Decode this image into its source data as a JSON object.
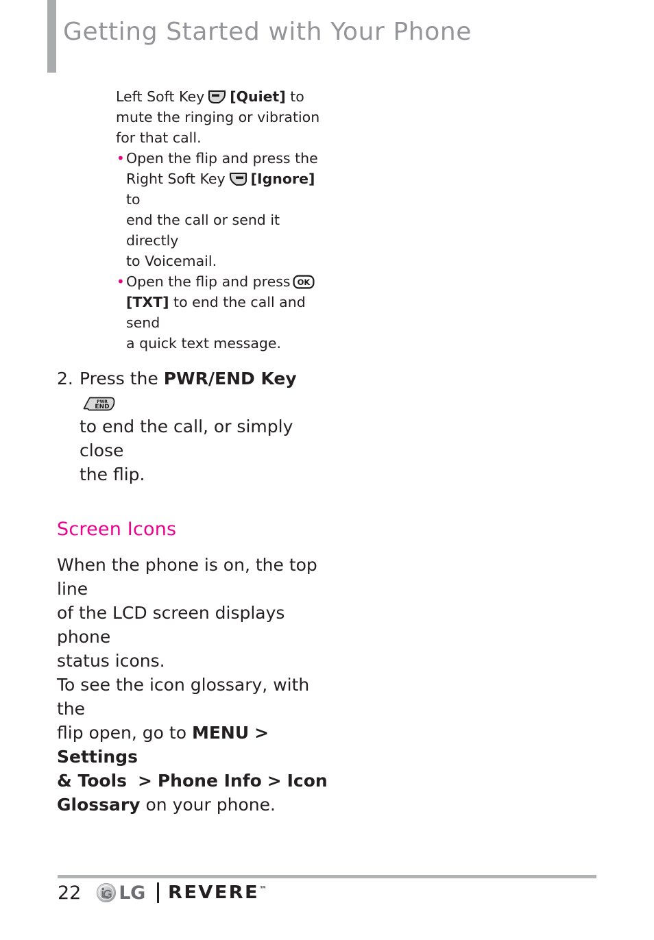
{
  "header": {
    "title": "Getting Started with Your Phone",
    "accent_bar_color": "#aaabad",
    "title_color": "#939598"
  },
  "colors": {
    "accent_pink": "#ec008c",
    "bullet_pink": "#e6007e",
    "body_text": "#231f20",
    "key_icon_fill": "#d9d9d9",
    "rule_gray": "#b1b3b5"
  },
  "content": {
    "intro_block": {
      "line1_prefix": "Left Soft Key",
      "left_soft_key_icon": "left-soft-key-icon",
      "line1_bold": "[Quiet]",
      "line1_suffix": "to",
      "line2": "mute the ringing or vibration",
      "line3": "for that call."
    },
    "bullets": [
      {
        "segments": [
          {
            "text": "Open the flip and press the",
            "bold": false
          },
          {
            "text": "Right Soft Key",
            "bold": false
          },
          {
            "icon": "right-soft-key-icon"
          },
          {
            "text": "[Ignore]",
            "bold": true
          },
          {
            "text": "to",
            "bold": false
          },
          {
            "text": "end the call or send it directly",
            "bold": false
          },
          {
            "text": "to Voicemail.",
            "bold": false
          }
        ],
        "line1": "Open the flip and press the",
        "line2_prefix": "Right Soft Key",
        "line2_bold": "[Ignore]",
        "line2_suffix": "to",
        "line3": "end the call or send it directly",
        "line4": "to Voicemail."
      },
      {
        "line1": "Open the flip and press",
        "icon": "ok-key-icon",
        "line2_bold": "[TXT]",
        "line2_suffix": "to end the call and send",
        "line3": "a quick text message."
      }
    ],
    "step_two": {
      "number": "2.",
      "prefix": "Press the",
      "bold": "PWR/END Key",
      "icon": "pwr-end-key-icon",
      "line2": "to end the call, or simply close",
      "line3": "the flip."
    },
    "section": {
      "heading": "Screen Icons",
      "para1_line1": "When the phone is on, the top line",
      "para1_line2": "of the LCD screen displays phone",
      "para1_line3": "status icons.",
      "para2_line1": "To see the icon glossary, with the",
      "para2_line2_prefix": "flip open, go to",
      "para2_menu": "MENU",
      "para2_sep1": ">",
      "para2_settings": "Settings",
      "para2_tools": "& Tools",
      "para2_sep2": ">",
      "para2_phone_info": "Phone Info",
      "para2_sep3": ">",
      "para2_icon": "Icon",
      "para2_glossary": "Glossary",
      "para2_tail": "on your phone."
    }
  },
  "key_icons": {
    "left_soft_key_label": "left-soft-key",
    "right_soft_key_label": "right-soft-key",
    "ok_key_text": "OK",
    "pwr_key_line1": "PWR",
    "pwr_key_line2": "END"
  },
  "footer": {
    "page_number": "22",
    "brand": "LG",
    "model": "REVERE",
    "trademark": "™"
  }
}
